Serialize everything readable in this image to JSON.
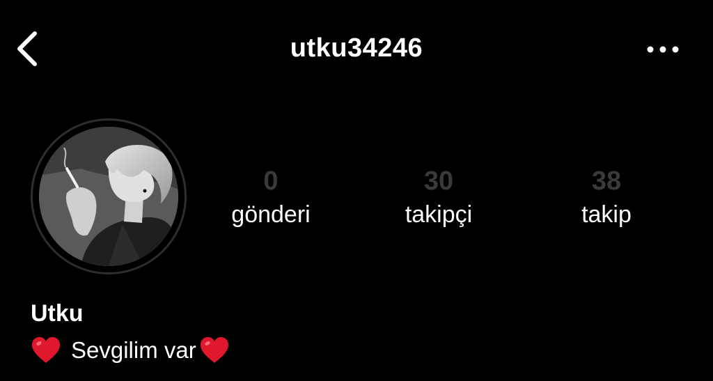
{
  "header": {
    "back_icon": "chevron-left-icon",
    "username": "utku34246",
    "more_icon": "ellipsis-horizontal-icon"
  },
  "profile": {
    "avatar": "avatar-image",
    "stats": [
      {
        "value": "0",
        "label": "gönderi"
      },
      {
        "value": "30",
        "label": "takipçi"
      },
      {
        "value": "38",
        "label": "takip"
      }
    ],
    "name": "Utku",
    "bio": {
      "leading_icon": "red-heart-icon",
      "text": "Sevgilim var",
      "trailing_icon": "red-heart-icon"
    }
  },
  "colors": {
    "background": "#000000",
    "text": "#ffffff",
    "stat_value": "#3a3a3a",
    "heart": "#e0182d"
  }
}
